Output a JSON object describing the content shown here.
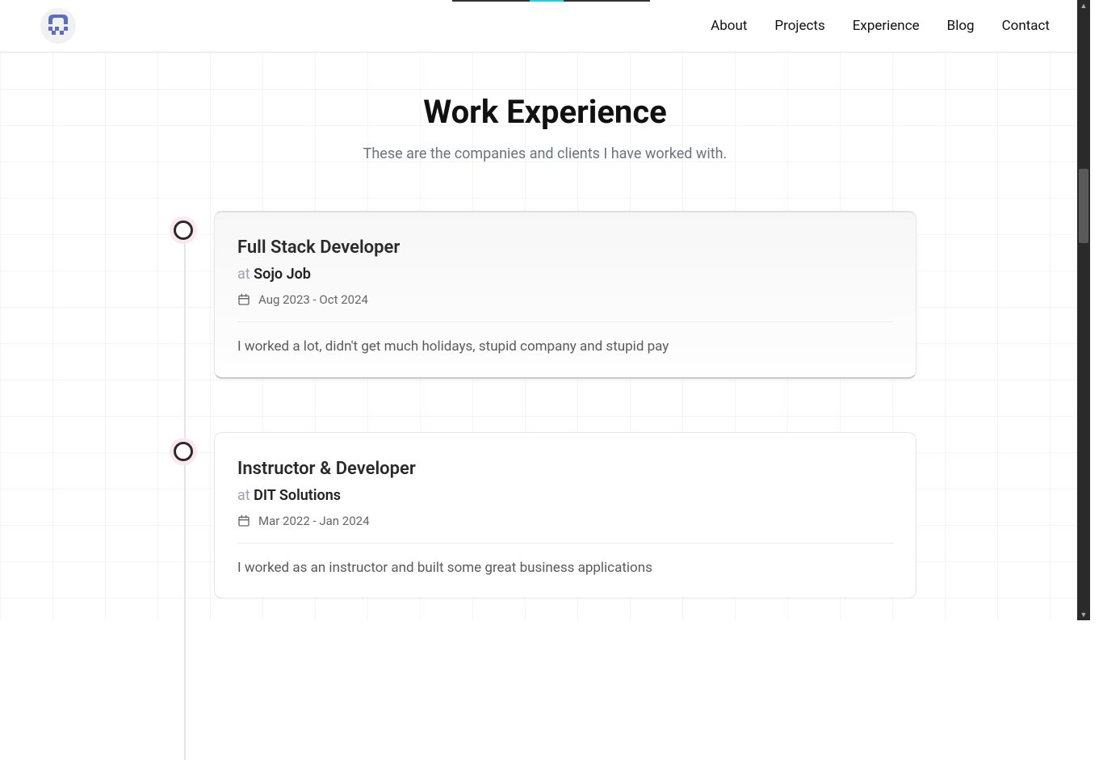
{
  "nav": {
    "items": [
      {
        "label": "About"
      },
      {
        "label": "Projects"
      },
      {
        "label": "Experience"
      },
      {
        "label": "Blog"
      },
      {
        "label": "Contact"
      }
    ]
  },
  "page": {
    "title": "Work Experience",
    "subtitle": "These are the companies and clients I have worked with."
  },
  "experience": [
    {
      "role": "Full Stack Developer",
      "at_label": "at",
      "company": "Sojo Job",
      "period": "Aug 2023 - Oct 2024",
      "description": "I worked a lot, didn't get much holidays, stupid company and stupid pay"
    },
    {
      "role": "Instructor & Developer",
      "at_label": "at",
      "company": "DIT Solutions",
      "period": "Mar 2022 - Jan 2024",
      "description": "I worked as an instructor and built some great business applications"
    }
  ]
}
